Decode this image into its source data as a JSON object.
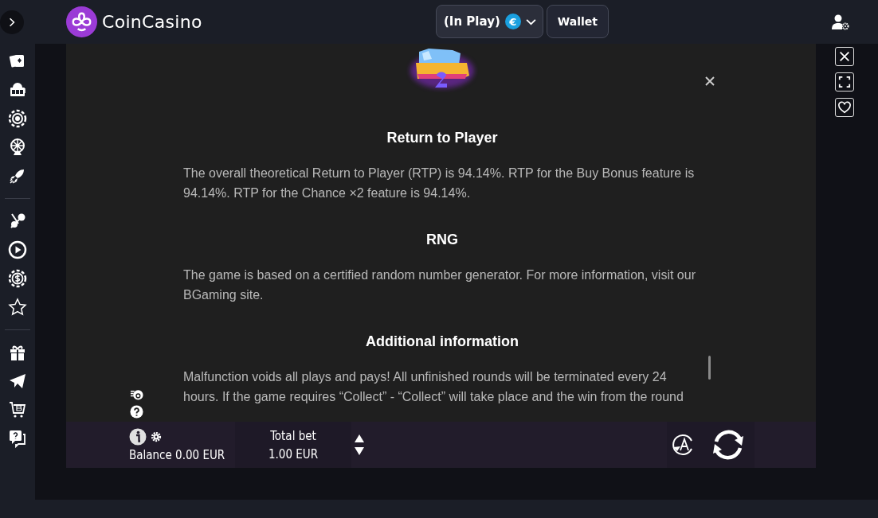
{
  "header": {
    "logo_text": "CoinCasino",
    "balance_button": {
      "label": "(In Play)",
      "currency": "€"
    },
    "wallet_button": "Wallet"
  },
  "game": {
    "sections": [
      {
        "heading": "Return to Player",
        "text": "The overall theoretical Return to Player (RTP) is 94.14%. RTP for the Buy Bonus feature is 94.14%. RTP for the Chance ×2 feature is 94.14%."
      },
      {
        "heading": "RNG",
        "text": "The game is based on a certified random number generator. For more information, visit our BGaming site."
      },
      {
        "heading": "Additional information",
        "text": "Malfunction voids all plays and pays! All unfinished rounds will be terminated every 24 hours. If the game requires “Collect” - “Collect” will take place and the win from the round"
      }
    ],
    "bar": {
      "balance": "Balance 0.00 EUR",
      "total_bet_label": "Total bet",
      "total_bet_value": "1.00 EUR"
    }
  }
}
